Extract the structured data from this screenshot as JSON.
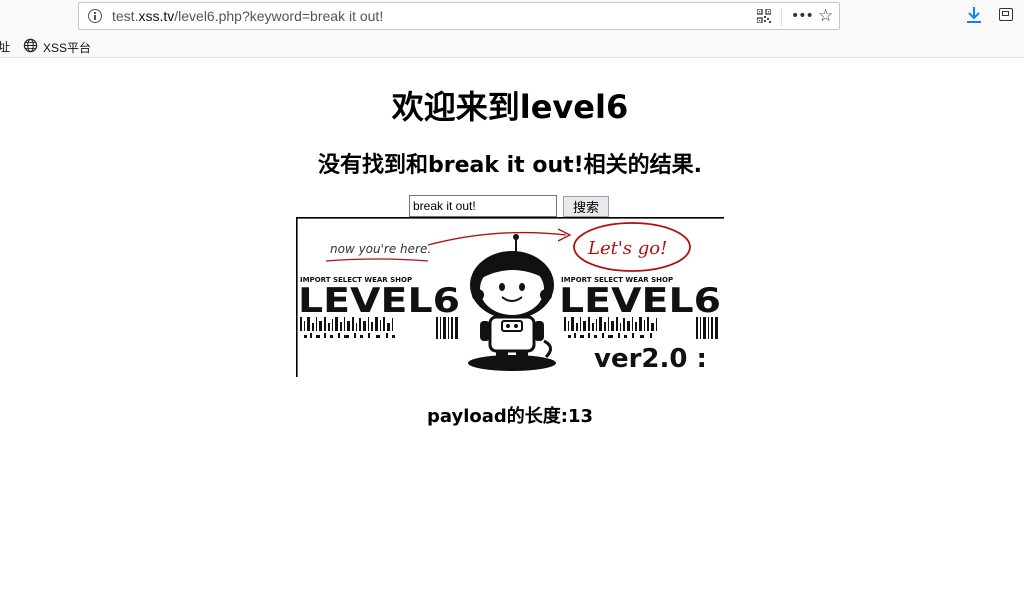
{
  "browser": {
    "url_prefix": "test.",
    "url_domain": "xss.tv",
    "url_path": "/level6.php?keyword=break it out!",
    "bookmark_partial": "址",
    "bookmark_label": "XSS平台"
  },
  "page": {
    "heading": "欢迎来到level6",
    "result_text": "没有找到和break it out!相关的结果.",
    "search_value": "break it out!",
    "search_button": "搜索",
    "payload_text": "payload的长度:13"
  },
  "banner": {
    "note_left": "now you're here.",
    "note_right": "Let's go!",
    "shop_left": "IMPORT SELECT WEAR SHOP",
    "shop_right": "IMPORT SELECT WEAR SHOP",
    "level_left": "LEVEL6",
    "level_right": "LEVEL6",
    "version": "ver2.0 :"
  },
  "colors": {
    "download_blue": "#0a84ff",
    "scribble_red": "#b01010"
  }
}
